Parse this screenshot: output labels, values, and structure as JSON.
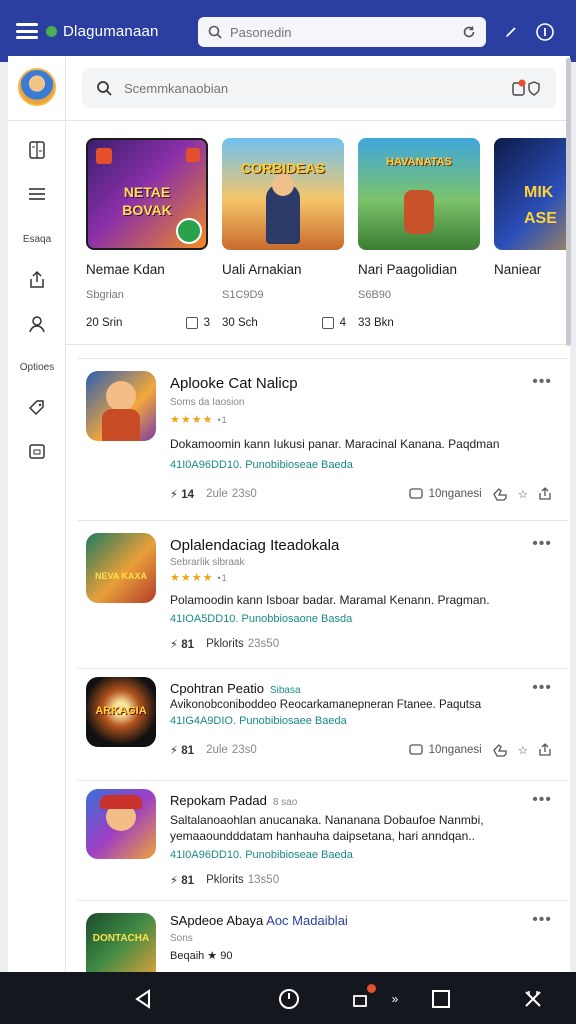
{
  "appbar": {
    "brand": "Dlagumanaan",
    "search_placeholder": "Pasonedin",
    "accent": "#2a3fa0",
    "status_icons": "▾ ▮ ▮"
  },
  "rail": {
    "label_1": "Esaqa",
    "label_2": "Optioes"
  },
  "main": {
    "search_placeholder": "Scemmkanaobian"
  },
  "featured": [
    {
      "title": "Nemae Kdan",
      "size": "Sbgrian",
      "downloads": "20 Srin",
      "rating_box": "3"
    },
    {
      "title": "Uali Arnakian",
      "size": "S1C9D9",
      "downloads": "30 Sch",
      "rating_box": "4"
    },
    {
      "title": "Nari Paagolidian",
      "size": "S6B90",
      "downloads": "33 Bkn",
      "rating_box": ""
    },
    {
      "title": "Naniear",
      "size": "",
      "downloads": "",
      "rating_box": ""
    }
  ],
  "featured_art_text": [
    {
      "line1": "NETAE",
      "line2": "BOVAK"
    },
    {
      "line1": "CORBIDEAS",
      "line2": ""
    },
    {
      "line1": "HAVANATAS",
      "line2": ""
    },
    {
      "line1": "MIK",
      "line2": "ASE"
    }
  ],
  "cards": [
    {
      "name": "Aplooke Cat Nalicp",
      "sub": "Soms da Iaosion",
      "stars": "★★★★",
      "star_count": "•1",
      "desc": "Dokamoomin kann Iukusi panar. Maracinal Kanana. Paqdman",
      "meta": "41I0A96DD10. Punobibioseae Baeda",
      "stat": "⚡ 14",
      "stat_label": "2ule",
      "stat_num": "23s0",
      "action_label": "10nganesi"
    },
    {
      "name": "Oplalendaciag Iteadokala",
      "sub": "Sebrarlik slbraak",
      "stars": "★★★★",
      "star_count": "•1",
      "desc": "Polamoodin kann Isboar badar. Maramal Kenann. Pragman.",
      "meta": "41IOA5DD10. Punobbiosaone Basda",
      "stat": "⚡ 81",
      "stat_label": "Pklorits",
      "stat_num": "23s50",
      "action_label": ""
    },
    {
      "name": "Cpohtran Peatio",
      "name_tag": "Sibasa",
      "sub": "Avikonobconiboddeo Reocarkamanepneran Ftanee. Paqutsa",
      "stars": "",
      "star_count": "",
      "desc": "",
      "meta": "41IG4A9DIO. Punobibiosaee Baeda",
      "stat": "⚡ 81",
      "stat_label": "2ule",
      "stat_num": "23s0",
      "action_label": "10nganesi"
    },
    {
      "name": "Repokam Padad",
      "name_tag": "8 sao",
      "sub": "",
      "stars": "",
      "star_count": "",
      "desc": "Saltalanoaohlan anucanaka. Nananana Dobaufoe Nanmbi,",
      "desc2": "yemaaoundddatam hanhauha daipsetana, hari anndqan..",
      "meta": "41I0A96DD10. Punobibioseae Baeda",
      "stat": "⚡ 81",
      "stat_label": "Pklorits",
      "stat_num": "13s50",
      "action_label": ""
    },
    {
      "name": "SApdeoe Abaya",
      "name_tag": "Aoc Madaiblai",
      "sub": "Sons",
      "stars": "",
      "star_count": "",
      "desc": "Beqaih ★ 90",
      "meta": "",
      "stat": "",
      "stat_label": "",
      "stat_num": "",
      "action_label": ""
    }
  ],
  "icons_art_text": [
    "",
    "NEVA KAXA",
    "ARKAGIA",
    "",
    "DONTACHA"
  ]
}
